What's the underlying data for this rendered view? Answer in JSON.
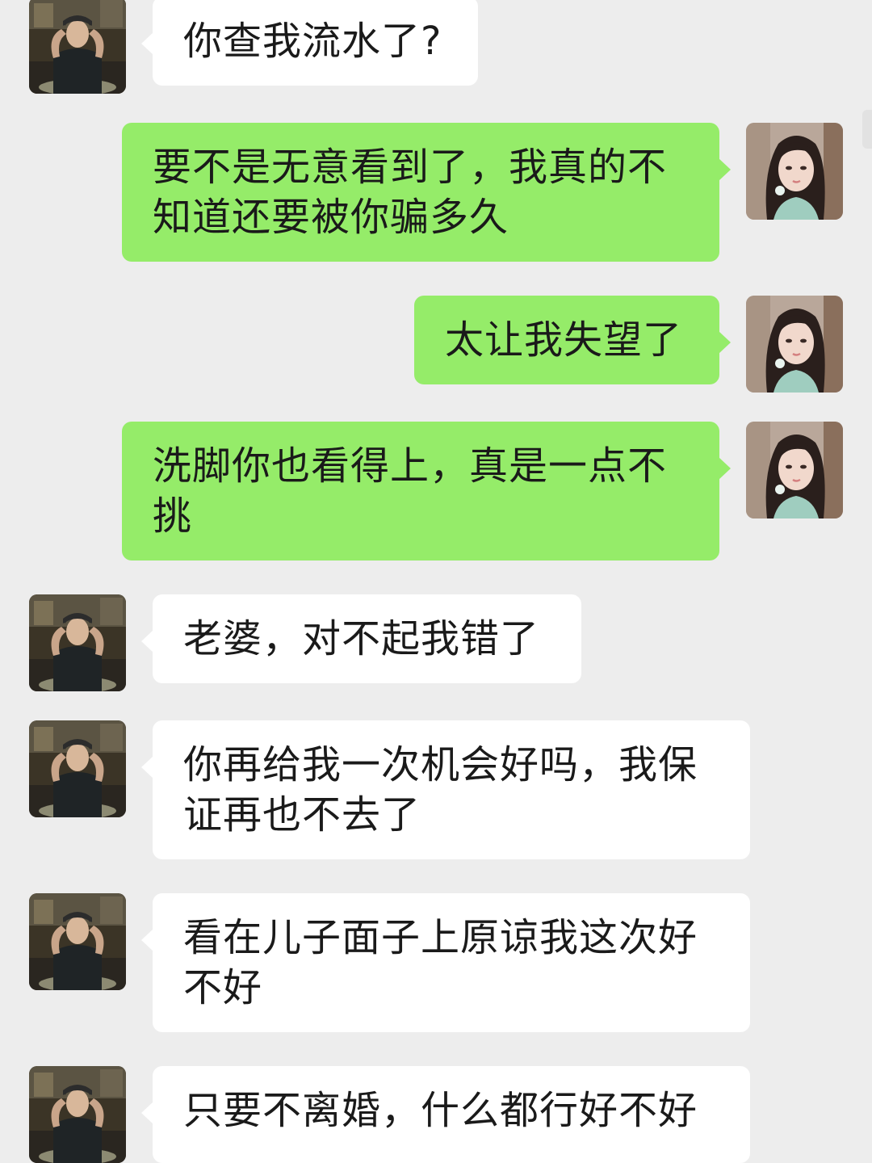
{
  "conversation": {
    "messages": [
      {
        "sender": "other",
        "text": "你查我流水了?"
      },
      {
        "sender": "me",
        "text": "要不是无意看到了，我真的不知道还要被你骗多久"
      },
      {
        "sender": "me",
        "text": "太让我失望了"
      },
      {
        "sender": "me",
        "text": "洗脚你也看得上，真是一点不挑"
      },
      {
        "sender": "other",
        "text": "老婆，对不起我错了"
      },
      {
        "sender": "other",
        "text": "你再给我一次机会好吗，我保证再也不去了"
      },
      {
        "sender": "other",
        "text": "看在儿子面子上原谅我这次好不好"
      },
      {
        "sender": "other",
        "text": "只要不离婚，什么都行好不好"
      }
    ]
  },
  "theme": {
    "background": "#ededed",
    "incoming_bubble": "#ffffff",
    "outgoing_bubble": "#95ec69",
    "text_color": "#1a1a1a"
  },
  "avatars": {
    "other": "male-avatar-photo",
    "me": "female-avatar-photo"
  }
}
